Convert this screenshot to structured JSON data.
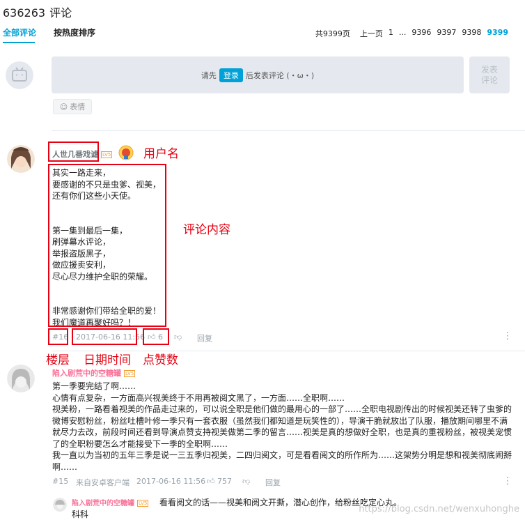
{
  "header": {
    "count": "636263",
    "title": "评论"
  },
  "tabs": [
    {
      "label": "全部评论"
    },
    {
      "label": "按热度排序"
    }
  ],
  "pager": {
    "total": "共9399页",
    "prev": "上一页",
    "pages": [
      "1",
      "...",
      "9396",
      "9397",
      "9398",
      "9399"
    ]
  },
  "composer": {
    "prompt_before": "请先",
    "login": "登录",
    "prompt_after": "后发表评论 (・ω・)",
    "send": "发表\n评论",
    "emoji": "表情"
  },
  "comments": [
    {
      "user": "人世几番戏谑",
      "level": "LV5",
      "text": "其实一路走来，\n要感谢的不只是虫爹、视美，\n还有你们这些小天使。\n\n\n第一集到最后一集，\n刷弹幕水评论，\n举报盗版黑子，\n做应援卖安利，\n尽心尽力维护全职的荣耀。\n\n\n非常感谢你们带给全职的爱！\n我们魔道再聚好吗？！",
      "floor": "#16",
      "time": "2017-06-16 11:56",
      "likes": "6",
      "reply": "回复"
    },
    {
      "user": "陷入剧荒中的空糖罐",
      "level": "LV5",
      "text": "第一季要完结了啊……\n心情有点复杂，一方面高兴视美终于不用再被阅文黑了，一方面……全职啊……\n视美粉，一路看着视美的作品走过来的，可以说全职是他们做的最用心的一部了……全职电视剧传出的时候视美还转了虫爹的微博安慰粉丝，粉丝吐槽叶修一季只有一套衣服（虽然我们都知道是玩笑性的），导演干脆就放出了队服，播放期间哪里不满就尽力去改，前段时间还看到导演点赞支持视美做第二季的留言……视美是真的想做好全职，也是真的重视粉丝，被视美宠惯了的全职粉要怎么才能接受下一季的全职啊……\n我一直以为当初的五年三季是说一三五季归视美，二四归阅文，可是看看阅文的所作所为……这架势分明是想和视美彻底闹掰啊……",
      "floor": "#15",
      "source": "来自安卓客户端",
      "time": "2017-06-16 11:56",
      "likes": "757",
      "reply": "回复"
    }
  ],
  "sub_reply": {
    "user": "陷入剧荒中的空糖罐",
    "level": "LV5",
    "text": "看看阅文的话——视美和阅文开撕，潜心创作，给粉丝吃定心丸。",
    "extra": "科科"
  },
  "annotations": {
    "username": "用户名",
    "content": "评论内容",
    "floor": "楼层",
    "datetime": "日期时间",
    "likes": "点赞数"
  },
  "watermark": "https://blog.csdn.net/wenxuhonghe",
  "colors": {
    "accent": "#00a1d6",
    "annotation": "#e60012",
    "pink": "#fb7299"
  }
}
